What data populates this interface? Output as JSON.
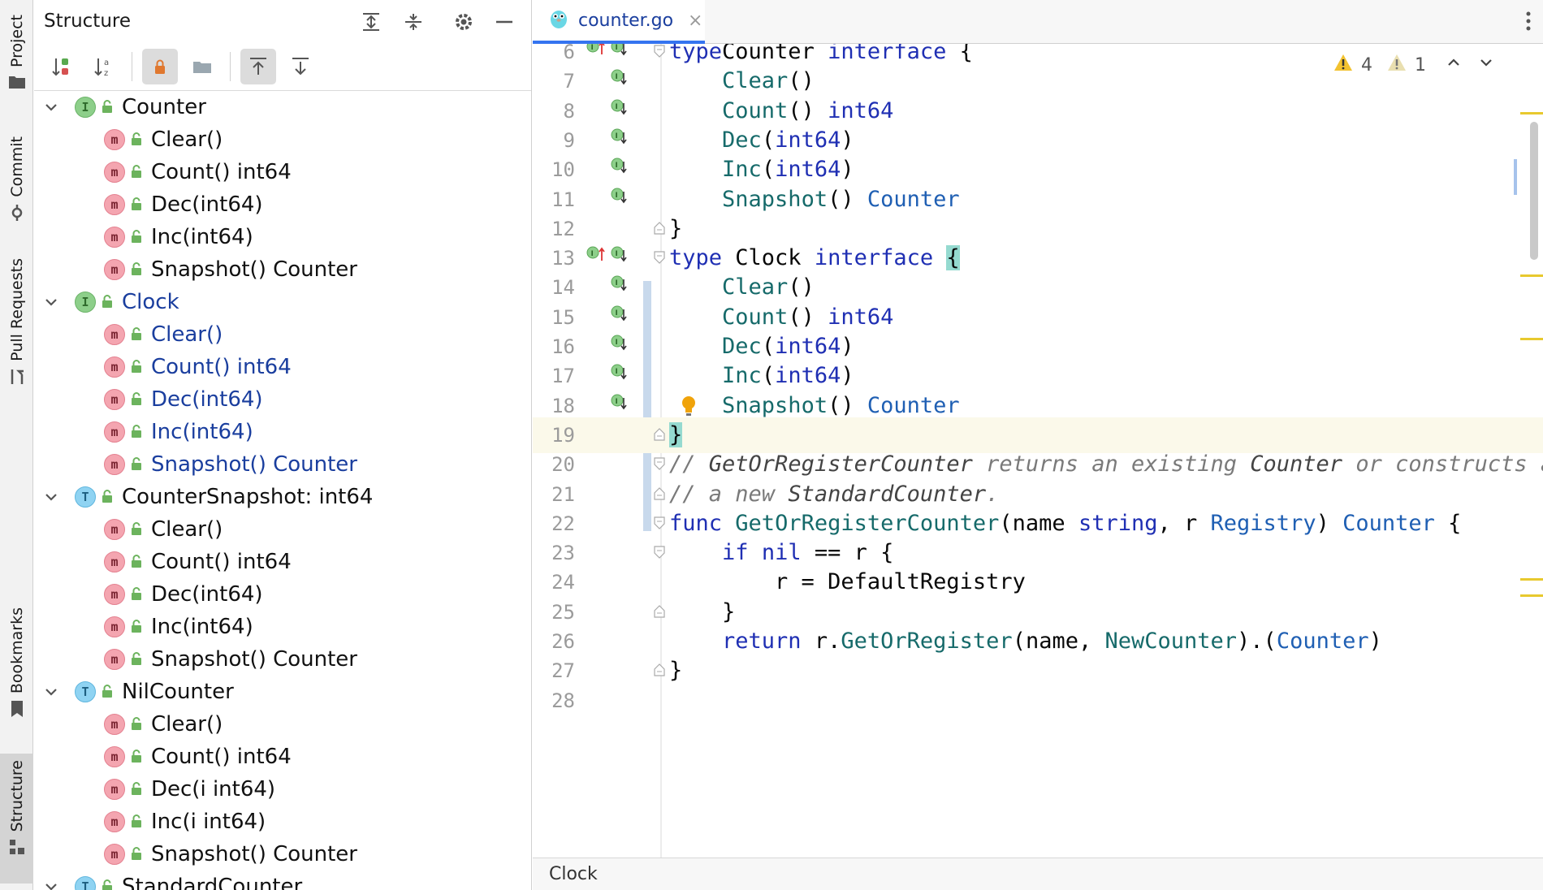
{
  "stripe": {
    "tabs": [
      {
        "label": "Project",
        "icon": "folder-icon"
      },
      {
        "label": "Commit",
        "icon": "commit-icon"
      },
      {
        "label": "Pull Requests",
        "icon": "pull-request-icon"
      },
      {
        "label": "Bookmarks",
        "icon": "bookmark-icon"
      },
      {
        "label": "Structure",
        "icon": "structure-icon",
        "active": true
      }
    ]
  },
  "structure": {
    "title": "Structure",
    "header_icons": [
      "expand-all-icon",
      "collapse-all-icon",
      "gear-icon",
      "minimize-icon"
    ],
    "toolbar_icons": [
      "sort-by-visibility-icon",
      "sort-alphabetically-icon",
      "show-private-icon",
      "show-fields-icon",
      "navigate-from-source-icon",
      "navigate-to-source-icon"
    ],
    "tree": [
      {
        "label": "Counter",
        "kind": "interface",
        "color": "normal",
        "children": [
          "Clear()",
          "Count() int64",
          "Dec(int64)",
          "Inc(int64)",
          "Snapshot() Counter"
        ]
      },
      {
        "label": "Clock",
        "kind": "interface",
        "color": "blue",
        "children": [
          "Clear()",
          "Count() int64",
          "Dec(int64)",
          "Inc(int64)",
          "Snapshot() Counter"
        ]
      },
      {
        "label": "CounterSnapshot: int64",
        "kind": "type",
        "color": "normal",
        "children": [
          "Clear()",
          "Count() int64",
          "Dec(int64)",
          "Inc(int64)",
          "Snapshot() Counter"
        ]
      },
      {
        "label": "NilCounter",
        "kind": "type",
        "color": "normal",
        "children": [
          "Clear()",
          "Count() int64",
          "Dec(i int64)",
          "Inc(i int64)",
          "Snapshot() Counter"
        ]
      },
      {
        "label": "StandardCounter",
        "kind": "type",
        "color": "normal",
        "children": []
      }
    ]
  },
  "editor": {
    "tab": {
      "filename": "counter.go",
      "close": "×"
    },
    "inspections": {
      "warnings": "4",
      "weak_warnings": "1"
    },
    "breadcrumb": "Clock",
    "lines": [
      {
        "n": "6",
        "tokens": [
          [
            "kw",
            "type"
          ],
          [
            "",
            "Counter "
          ],
          [
            "kw",
            "interface"
          ],
          [
            "",
            " {"
          ]
        ]
      },
      {
        "n": "7",
        "tokens": [
          [
            "",
            "    "
          ],
          [
            "fn",
            "Clear"
          ],
          [
            "",
            "()"
          ]
        ]
      },
      {
        "n": "8",
        "tokens": [
          [
            "",
            "    "
          ],
          [
            "fn",
            "Count"
          ],
          [
            "",
            "() "
          ],
          [
            "kw",
            "int64"
          ]
        ]
      },
      {
        "n": "9",
        "tokens": [
          [
            "",
            "    "
          ],
          [
            "fn",
            "Dec"
          ],
          [
            "",
            "("
          ],
          [
            "kw",
            "int64"
          ],
          [
            "",
            ")"
          ]
        ]
      },
      {
        "n": "10",
        "tokens": [
          [
            "",
            "    "
          ],
          [
            "fn",
            "Inc"
          ],
          [
            "",
            "("
          ],
          [
            "kw",
            "int64"
          ],
          [
            "",
            ")"
          ]
        ]
      },
      {
        "n": "11",
        "tokens": [
          [
            "",
            "    "
          ],
          [
            "fn",
            "Snapshot"
          ],
          [
            "",
            "() "
          ],
          [
            "ty",
            "Counter"
          ]
        ]
      },
      {
        "n": "12",
        "tokens": [
          [
            "",
            "}"
          ]
        ]
      },
      {
        "n": "13",
        "tokens": [
          [
            "kw",
            "type"
          ],
          [
            "",
            " Clock "
          ],
          [
            "kw",
            "interface"
          ],
          [
            "",
            " "
          ],
          [
            "hl",
            "{"
          ]
        ]
      },
      {
        "n": "14",
        "tokens": [
          [
            "",
            "    "
          ],
          [
            "fn",
            "Clear"
          ],
          [
            "",
            "()"
          ]
        ]
      },
      {
        "n": "15",
        "tokens": [
          [
            "",
            "    "
          ],
          [
            "fn",
            "Count"
          ],
          [
            "",
            "() "
          ],
          [
            "kw",
            "int64"
          ]
        ]
      },
      {
        "n": "16",
        "tokens": [
          [
            "",
            "    "
          ],
          [
            "fn",
            "Dec"
          ],
          [
            "",
            "("
          ],
          [
            "kw",
            "int64"
          ],
          [
            "",
            ")"
          ]
        ]
      },
      {
        "n": "17",
        "tokens": [
          [
            "",
            "    "
          ],
          [
            "fn",
            "Inc"
          ],
          [
            "",
            "("
          ],
          [
            "kw",
            "int64"
          ],
          [
            "",
            ")"
          ]
        ]
      },
      {
        "n": "18",
        "tokens": [
          [
            "",
            "    "
          ],
          [
            "fn",
            "Snapshot"
          ],
          [
            "",
            "() "
          ],
          [
            "ty",
            "Counter"
          ]
        ]
      },
      {
        "n": "19",
        "tokens": [
          [
            "hl",
            "}"
          ]
        ]
      },
      {
        "n": "20",
        "tokens": [
          [
            "cm",
            "// "
          ],
          [
            "cmb",
            "GetOrRegisterCounter"
          ],
          [
            "cm",
            " returns an existing "
          ],
          [
            "cmb",
            "Counter"
          ],
          [
            "cm",
            " or constructs and registers"
          ]
        ]
      },
      {
        "n": "21",
        "tokens": [
          [
            "cm",
            "// a new "
          ],
          [
            "cmb",
            "StandardCounter"
          ],
          [
            "cm",
            "."
          ]
        ]
      },
      {
        "n": "22",
        "tokens": [
          [
            "kw",
            "func"
          ],
          [
            "",
            " "
          ],
          [
            "fn",
            "GetOrRegisterCounter"
          ],
          [
            "",
            "(name "
          ],
          [
            "kw",
            "string"
          ],
          [
            "",
            ", r "
          ],
          [
            "ty",
            "Registry"
          ],
          [
            "",
            ") "
          ],
          [
            "ty",
            "Counter"
          ],
          [
            "",
            " {"
          ]
        ]
      },
      {
        "n": "23",
        "tokens": [
          [
            "",
            "    "
          ],
          [
            "kw",
            "if"
          ],
          [
            "",
            " "
          ],
          [
            "kw",
            "nil"
          ],
          [
            "",
            " == r {"
          ]
        ]
      },
      {
        "n": "24",
        "tokens": [
          [
            "",
            "        r = DefaultRegistry"
          ]
        ]
      },
      {
        "n": "25",
        "tokens": [
          [
            "",
            "    }"
          ]
        ]
      },
      {
        "n": "26",
        "tokens": [
          [
            "",
            "    "
          ],
          [
            "kw",
            "return"
          ],
          [
            "",
            " r."
          ],
          [
            "fn",
            "GetOrRegister"
          ],
          [
            "",
            "(name, "
          ],
          [
            "fn",
            "NewCounter"
          ],
          [
            "",
            ").("
          ],
          [
            "ty",
            "Counter"
          ],
          [
            "",
            ")"
          ]
        ]
      },
      {
        "n": "27",
        "tokens": [
          [
            "",
            "}"
          ]
        ]
      },
      {
        "n": "28",
        "tokens": []
      }
    ]
  }
}
